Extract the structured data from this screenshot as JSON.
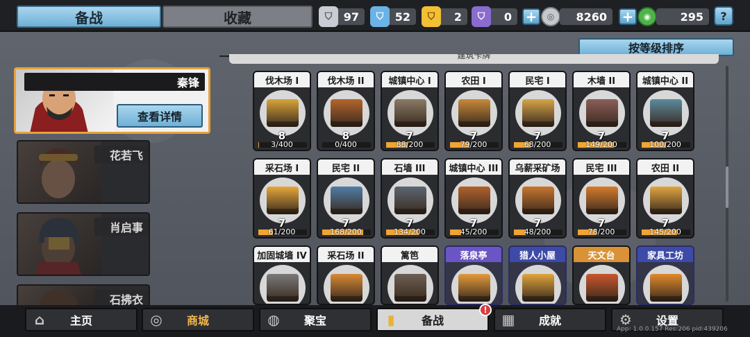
{
  "tabs": {
    "active": "备战",
    "inactive": "收藏"
  },
  "resources": [
    {
      "icon": "silver-shield-icon",
      "value": "97",
      "color": "#c9ccd2"
    },
    {
      "icon": "blue-shield-icon",
      "value": "52",
      "color": "#6ab3e6"
    },
    {
      "icon": "gold-shield-icon",
      "value": "2",
      "color": "#f2c033"
    },
    {
      "icon": "purple-shield-icon",
      "value": "0",
      "color": "#8a6ccf"
    }
  ],
  "currency": {
    "silver": "8260",
    "green": "295"
  },
  "help": "?",
  "sort_button": "按等级排序",
  "section_title": "建筑卡牌",
  "heroes": [
    {
      "name": "秦锋",
      "selected": true
    },
    {
      "name": "花若飞",
      "selected": false
    },
    {
      "name": "肖启事",
      "selected": false
    },
    {
      "name": "石拂衣",
      "selected": false
    }
  ],
  "detail_button": "查看详情",
  "buildings": [
    {
      "name": "伐木场 I",
      "level": "8",
      "count": "3/400",
      "progress": 0.0075,
      "rarity": "common",
      "color": "#d9a53a"
    },
    {
      "name": "伐木场 II",
      "level": "8",
      "count": "0/400",
      "progress": 0,
      "rarity": "common",
      "color": "#b5652d"
    },
    {
      "name": "城镇中心 I",
      "level": "7",
      "count": "88/200",
      "progress": 0.44,
      "rarity": "common",
      "color": "#8a7a66"
    },
    {
      "name": "农田 I",
      "level": "7",
      "count": "79/200",
      "progress": 0.395,
      "rarity": "common",
      "color": "#c88a3a"
    },
    {
      "name": "民宅 I",
      "level": "7",
      "count": "68/200",
      "progress": 0.34,
      "rarity": "common",
      "color": "#d6a547"
    },
    {
      "name": "木墙 II",
      "level": "7",
      "count": "149/200",
      "progress": 0.745,
      "rarity": "common",
      "color": "#8b5e5a"
    },
    {
      "name": "城镇中心 II",
      "level": "7",
      "count": "100/200",
      "progress": 0.5,
      "rarity": "common",
      "color": "#5c8ba0"
    },
    {
      "name": "采石场 I",
      "level": "7",
      "count": "61/200",
      "progress": 0.305,
      "rarity": "common",
      "color": "#e6a83a"
    },
    {
      "name": "民宅 II",
      "level": "7",
      "count": "168/200",
      "progress": 0.84,
      "rarity": "common",
      "color": "#4f7ea6"
    },
    {
      "name": "石墙 III",
      "level": "7",
      "count": "134/200",
      "progress": 0.67,
      "rarity": "common",
      "color": "#5b6672"
    },
    {
      "name": "城镇中心 III",
      "level": "7",
      "count": "45/200",
      "progress": 0.225,
      "rarity": "common",
      "color": "#b0622c"
    },
    {
      "name": "乌薪采矿场",
      "level": "7",
      "count": "48/200",
      "progress": 0.24,
      "rarity": "common",
      "color": "#c8762e"
    },
    {
      "name": "民宅 III",
      "level": "7",
      "count": "78/200",
      "progress": 0.39,
      "rarity": "common",
      "color": "#d57b2c"
    },
    {
      "name": "农田 II",
      "level": "7",
      "count": "145/200",
      "progress": 0.725,
      "rarity": "common",
      "color": "#e0a640"
    },
    {
      "name": "加固城墙 IV",
      "level": "",
      "count": "",
      "progress": 0,
      "rarity": "common",
      "color": "#7a7a7a"
    },
    {
      "name": "采石场 II",
      "level": "",
      "count": "",
      "progress": 0,
      "rarity": "common",
      "color": "#d88a36"
    },
    {
      "name": "篱笆",
      "level": "",
      "count": "",
      "progress": 0,
      "rarity": "common",
      "color": "#6b5e52"
    },
    {
      "name": "落泉亭",
      "level": "",
      "count": "",
      "progress": 0,
      "rarity": "purple",
      "color": "#e39a3a"
    },
    {
      "name": "猎人小屋",
      "level": "",
      "count": "",
      "progress": 0,
      "rarity": "navy",
      "color": "#e0a43c"
    },
    {
      "name": "天文台",
      "level": "",
      "count": "",
      "progress": 0,
      "rarity": "orange",
      "color": "#c9562c"
    },
    {
      "name": "家具工坊",
      "level": "",
      "count": "",
      "progress": 0,
      "rarity": "navy",
      "color": "#e08a2c"
    }
  ],
  "nav": [
    {
      "label": "主页",
      "icon": "home-icon"
    },
    {
      "label": "商城",
      "icon": "coins-icon"
    },
    {
      "label": "聚宝",
      "icon": "treasure-icon"
    },
    {
      "label": "备战",
      "icon": "card-icon"
    },
    {
      "label": "成就",
      "icon": "achievement-icon"
    },
    {
      "label": "设置",
      "icon": "gear-icon"
    }
  ],
  "alert_badge": "!",
  "version": "App: 1.0.0.157 Res:206 pid:439206"
}
